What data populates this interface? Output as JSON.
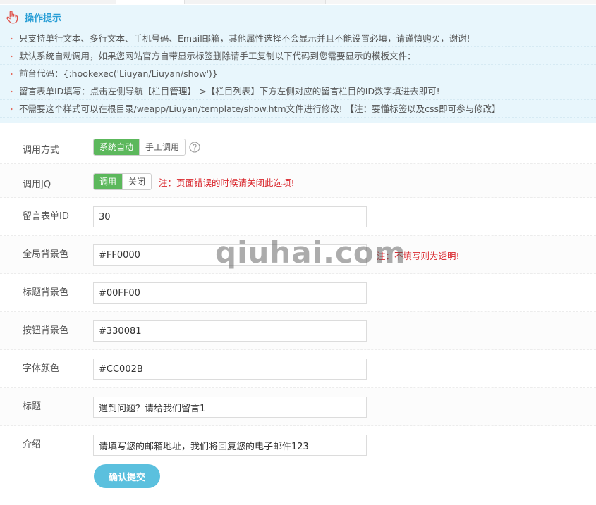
{
  "tips": {
    "title": "操作提示",
    "icon": "hand-pointer-icon",
    "items": [
      "只支持单行文本、多行文本、手机号码、Email邮箱，其他属性选择不会显示并且不能设置必填，请谨慎购买，谢谢!",
      "默认系统自动调用，如果您网站官方自带显示标签删除请手工复制以下代码到您需要显示的模板文件：",
      "前台代码：{:hookexec('Liuyan/Liuyan/show')}",
      "留言表单ID填写：点击左侧导航【栏目管理】->【栏目列表】下方左侧对应的留言栏目的ID数字填进去即可!",
      "不需要这个样式可以在根目录/weapp/Liuyan/template/show.htm文件进行修改! 【注：要懂标签以及css即可参与修改】"
    ]
  },
  "form": {
    "call_mode": {
      "label": "调用方式",
      "options": [
        "系统自动",
        "手工调用"
      ],
      "selected": "系统自动"
    },
    "call_jq": {
      "label": "调用JQ",
      "options": [
        "调用",
        "关闭"
      ],
      "selected": "调用",
      "note": "注：页面错误的时候请关闭此选项!"
    },
    "form_id": {
      "label": "留言表单ID",
      "value": "30"
    },
    "global_bg": {
      "label": "全局背景色",
      "value": "#FF0000",
      "note": "注：不填写则为透明!"
    },
    "title_bg": {
      "label": "标题背景色",
      "value": "#00FF00"
    },
    "button_bg": {
      "label": "按钮背景色",
      "value": "#330081"
    },
    "font_color": {
      "label": "字体颜色",
      "value": "#CC002B"
    },
    "title": {
      "label": "标题",
      "value": "遇到问题？请给我们留言1"
    },
    "intro": {
      "label": "介绍",
      "value": "请填写您的邮箱地址，我们将回复您的电子邮件123"
    }
  },
  "submit_label": "确认提交",
  "watermark": "qiuhai.com",
  "colors": {
    "accent": "#2a9fd6",
    "tips_bg": "#e8f6fc",
    "toggle_on": "#5cb85c",
    "warning": "#d9262c",
    "submit": "#5bc0de"
  }
}
